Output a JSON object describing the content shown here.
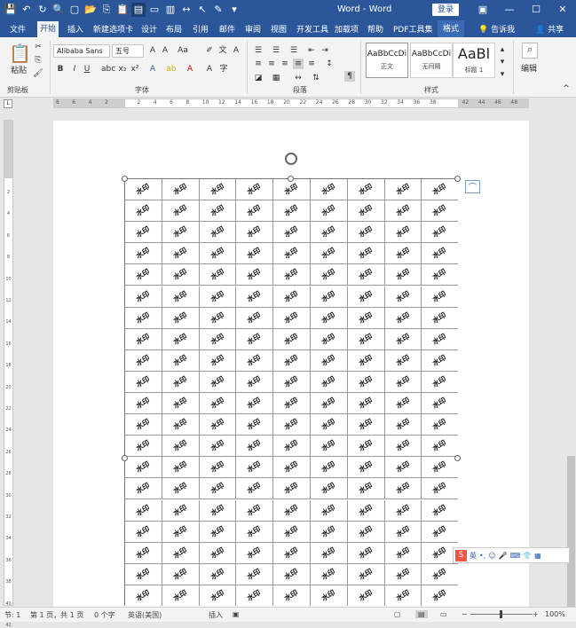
{
  "window": {
    "title": "Word - Word",
    "login": "登录"
  },
  "tabs": [
    "文件",
    "开始",
    "插入",
    "新建选项卡",
    "设计",
    "布局",
    "引用",
    "邮件",
    "审阅",
    "视图",
    "开发工具",
    "加载项",
    "帮助",
    "PDF工具集",
    "格式"
  ],
  "tell_me": "告诉我",
  "share": "共享",
  "ribbon": {
    "paste": "粘贴",
    "clipboard": "剪贴板",
    "font_name": "Alibaba Sans",
    "font_size": "五号",
    "font_group": "字体",
    "para_group": "段落",
    "styles_group": "样式",
    "styles": [
      {
        "preview": "AaBbCcDi",
        "caption": "正文"
      },
      {
        "preview": "AaBbCcDi",
        "caption": "无间隔"
      },
      {
        "preview": "AaBl",
        "caption": "标题 1"
      }
    ],
    "edit": "编辑"
  },
  "ruler_h": [
    "8",
    "6",
    "4",
    "2",
    "",
    "2",
    "4",
    "6",
    "8",
    "10",
    "12",
    "14",
    "16",
    "18",
    "20",
    "22",
    "24",
    "26",
    "28",
    "30",
    "32",
    "34",
    "36",
    "38",
    "",
    "42",
    "44",
    "46",
    "48"
  ],
  "ruler_v": [
    "2",
    "4",
    "6",
    "8",
    "10",
    "12",
    "14",
    "16",
    "18",
    "20",
    "22",
    "24",
    "26",
    "28",
    "30",
    "32",
    "34",
    "36",
    "38",
    "40",
    "42"
  ],
  "watermark": "水印",
  "ime": {
    "lang": "英"
  },
  "status": {
    "section": "节: 1",
    "page": "第 1 页，共 1 页",
    "words": "0 个字",
    "lang": "英语(美国)",
    "mode": "插入",
    "zoom": "100%"
  }
}
